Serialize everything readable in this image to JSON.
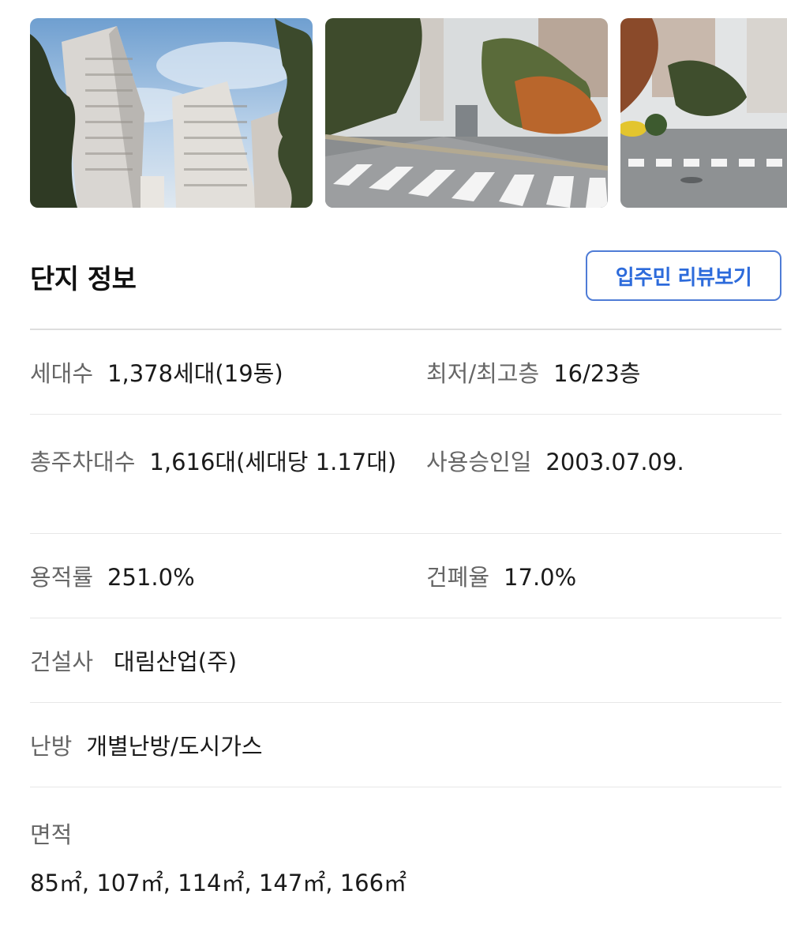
{
  "photos": [
    {
      "name": "apartment-towers-photo"
    },
    {
      "name": "entrance-crosswalk-photo"
    },
    {
      "name": "complex-road-photo"
    }
  ],
  "header": {
    "title": "단지 정보",
    "review_button": "입주민 리뷰보기"
  },
  "info": {
    "households": {
      "label": "세대수",
      "value": "1,378세대(19동)"
    },
    "floors": {
      "label": "최저/최고층",
      "value": "16/23층"
    },
    "parking": {
      "label": "총주차대수",
      "value": "1,616대(세대당 1.17대)"
    },
    "approval_date": {
      "label": "사용승인일",
      "value": "2003.07.09."
    },
    "floor_area_ratio": {
      "label": "용적률",
      "value": "251.0%"
    },
    "building_coverage": {
      "label": "건폐율",
      "value": "17.0%"
    },
    "builder": {
      "label": "건설사",
      "value": "대림산업(주)"
    },
    "heating": {
      "label": "난방",
      "value": "개별난방/도시가스"
    },
    "area": {
      "label": "면적",
      "value": "85㎡, 107㎡, 114㎡, 147㎡, 166㎡"
    }
  },
  "colors": {
    "accent": "#2d6bdb",
    "accent_border": "#4f7cd6",
    "label": "#666666",
    "divider": "#e7e7e7"
  }
}
